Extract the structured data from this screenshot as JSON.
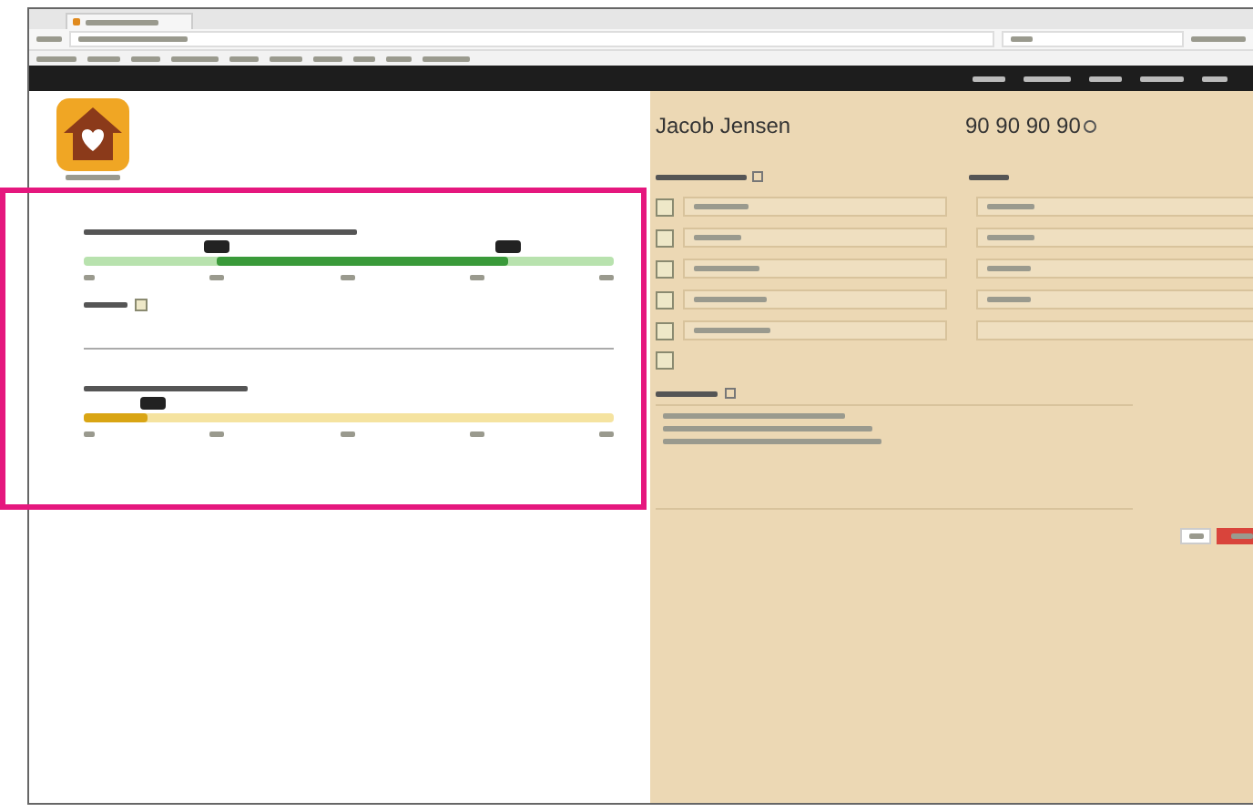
{
  "contact": {
    "name": "Jacob Jensen",
    "phone": "90 90 90 90"
  },
  "range_slider": {
    "handles": [
      {
        "level": 0.25
      },
      {
        "level": 0.8
      }
    ]
  },
  "private_option": {
    "checked": false
  },
  "single_slider": {
    "level": 0.12
  },
  "rows": [
    {
      "checked": false
    },
    {
      "checked": false
    },
    {
      "checked": false
    },
    {
      "checked": false
    },
    {
      "checked": false
    },
    {
      "checked": false
    }
  ]
}
